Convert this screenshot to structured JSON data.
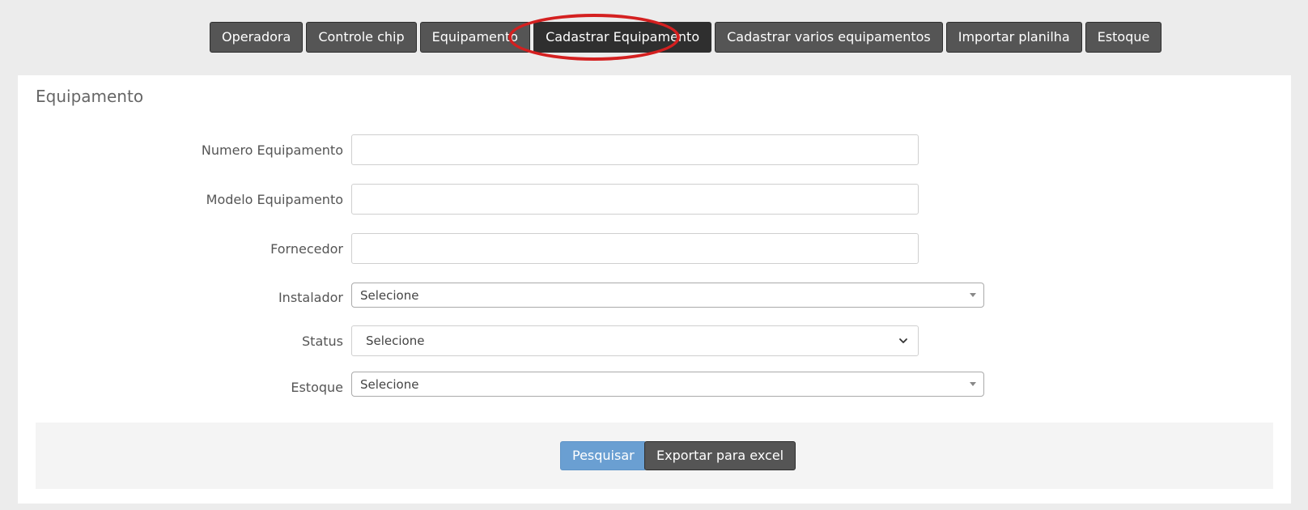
{
  "topnav": {
    "items": [
      {
        "label": "Operadora"
      },
      {
        "label": "Controle chip"
      },
      {
        "label": "Equipamento"
      },
      {
        "label": "Cadastrar Equipamento"
      },
      {
        "label": "Cadastrar varios equipamentos"
      },
      {
        "label": "Importar planilha"
      },
      {
        "label": "Estoque"
      }
    ],
    "highlight_color": "#d42020"
  },
  "panel": {
    "title": "Equipamento"
  },
  "form": {
    "numero": {
      "label": "Numero Equipamento",
      "value": ""
    },
    "modelo": {
      "label": "Modelo Equipamento",
      "value": ""
    },
    "fornecedor": {
      "label": "Fornecedor",
      "value": ""
    },
    "instalador": {
      "label": "Instalador",
      "value": "Selecione"
    },
    "status": {
      "label": "Status",
      "value": "Selecione"
    },
    "estoque": {
      "label": "Estoque",
      "value": "Selecione"
    }
  },
  "actions": {
    "search_label": "Pesquisar",
    "export_label": "Exportar para excel",
    "primary_color": "#6a9fd2"
  }
}
